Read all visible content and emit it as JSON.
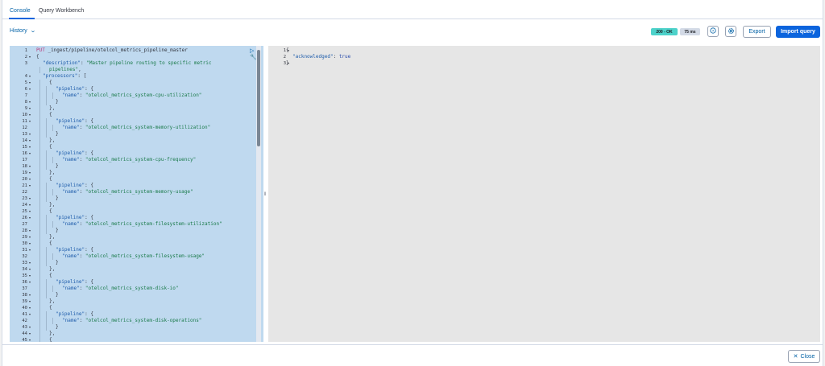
{
  "tabs": [
    {
      "label": "Console",
      "active": true
    },
    {
      "label": "Query Workbench",
      "active": false
    }
  ],
  "history_label": "History",
  "status": {
    "code": "200 - OK",
    "time": "75 ms"
  },
  "toolbar": {
    "export_label": "Export",
    "import_label": "Import query",
    "help_icon": "help-icon",
    "settings_icon": "gear-icon"
  },
  "request": {
    "method": "PUT",
    "url": " _ingest/pipeline/otelcol_metrics_pipeline_master"
  },
  "editor_lines": [
    {
      "n": "1",
      "fold": "",
      "indent": 0,
      "html": "<span class='tok-method'>PUT</span><span class='tok-url'> _ingest/pipeline/otelcol_metrics_pipeline_master</span>"
    },
    {
      "n": "2",
      "fold": "▾",
      "indent": 0,
      "html": "{"
    },
    {
      "n": "3",
      "fold": "",
      "indent": 1,
      "html": "<span class='tok-key'>\"description\"</span>: <span class='tok-str'>\"Master pipeline routing to specific metric</span>"
    },
    {
      "n": "",
      "fold": "",
      "indent": 2,
      "html": "<span class='tok-str'>pipelines\"</span>,"
    },
    {
      "n": "4",
      "fold": "▾",
      "indent": 1,
      "html": "<span class='tok-key'>\"processors\"</span>: ["
    },
    {
      "n": "5",
      "fold": "▾",
      "indent": 2,
      "html": "{"
    },
    {
      "n": "6",
      "fold": "▾",
      "indent": 3,
      "html": "<span class='tok-key'>\"pipeline\"</span>: {"
    },
    {
      "n": "7",
      "fold": "",
      "indent": 4,
      "html": "<span class='tok-key'>\"name\"</span>: <span class='tok-str'>\"otelcol_metrics_system-cpu-utilization\"</span>"
    },
    {
      "n": "8",
      "fold": "▾",
      "indent": 3,
      "html": "}"
    },
    {
      "n": "9",
      "fold": "▾",
      "indent": 2,
      "html": "},"
    },
    {
      "n": "10",
      "fold": "▾",
      "indent": 2,
      "html": "{"
    },
    {
      "n": "11",
      "fold": "▾",
      "indent": 3,
      "html": "<span class='tok-key'>\"pipeline\"</span>: {"
    },
    {
      "n": "12",
      "fold": "",
      "indent": 4,
      "html": "<span class='tok-key'>\"name\"</span>: <span class='tok-str'>\"otelcol_metrics_system-memory-utilization\"</span>"
    },
    {
      "n": "13",
      "fold": "▾",
      "indent": 3,
      "html": "}"
    },
    {
      "n": "14",
      "fold": "▾",
      "indent": 2,
      "html": "},"
    },
    {
      "n": "15",
      "fold": "▾",
      "indent": 2,
      "html": "{"
    },
    {
      "n": "16",
      "fold": "▾",
      "indent": 3,
      "html": "<span class='tok-key'>\"pipeline\"</span>: {"
    },
    {
      "n": "17",
      "fold": "",
      "indent": 4,
      "html": "<span class='tok-key'>\"name\"</span>: <span class='tok-str'>\"otelcol_metrics_system-cpu-frequency\"</span>"
    },
    {
      "n": "18",
      "fold": "▾",
      "indent": 3,
      "html": "}"
    },
    {
      "n": "19",
      "fold": "▾",
      "indent": 2,
      "html": "},"
    },
    {
      "n": "20",
      "fold": "▾",
      "indent": 2,
      "html": "{"
    },
    {
      "n": "21",
      "fold": "▾",
      "indent": 3,
      "html": "<span class='tok-key'>\"pipeline\"</span>: {"
    },
    {
      "n": "22",
      "fold": "",
      "indent": 4,
      "html": "<span class='tok-key'>\"name\"</span>: <span class='tok-str'>\"otelcol_metrics_system-memory-usage\"</span>"
    },
    {
      "n": "23",
      "fold": "▾",
      "indent": 3,
      "html": "}"
    },
    {
      "n": "24",
      "fold": "▾",
      "indent": 2,
      "html": "},"
    },
    {
      "n": "25",
      "fold": "▾",
      "indent": 2,
      "html": "{"
    },
    {
      "n": "26",
      "fold": "▾",
      "indent": 3,
      "html": "<span class='tok-key'>\"pipeline\"</span>: {"
    },
    {
      "n": "27",
      "fold": "",
      "indent": 4,
      "html": "<span class='tok-key'>\"name\"</span>: <span class='tok-str'>\"otelcol_metrics_system-filesystem-utilization\"</span>"
    },
    {
      "n": "28",
      "fold": "▾",
      "indent": 3,
      "html": "}"
    },
    {
      "n": "29",
      "fold": "▾",
      "indent": 2,
      "html": "},"
    },
    {
      "n": "30",
      "fold": "▾",
      "indent": 2,
      "html": "{"
    },
    {
      "n": "31",
      "fold": "▾",
      "indent": 3,
      "html": "<span class='tok-key'>\"pipeline\"</span>: {"
    },
    {
      "n": "32",
      "fold": "",
      "indent": 4,
      "html": "<span class='tok-key'>\"name\"</span>: <span class='tok-str'>\"otelcol_metrics_system-filesystem-usage\"</span>"
    },
    {
      "n": "33",
      "fold": "▾",
      "indent": 3,
      "html": "}"
    },
    {
      "n": "34",
      "fold": "▾",
      "indent": 2,
      "html": "},"
    },
    {
      "n": "35",
      "fold": "▾",
      "indent": 2,
      "html": "{"
    },
    {
      "n": "36",
      "fold": "▾",
      "indent": 3,
      "html": "<span class='tok-key'>\"pipeline\"</span>: {"
    },
    {
      "n": "37",
      "fold": "",
      "indent": 4,
      "html": "<span class='tok-key'>\"name\"</span>: <span class='tok-str'>\"otelcol_metrics_system-disk-io\"</span>"
    },
    {
      "n": "38",
      "fold": "▾",
      "indent": 3,
      "html": "}"
    },
    {
      "n": "39",
      "fold": "▾",
      "indent": 2,
      "html": "},"
    },
    {
      "n": "40",
      "fold": "▾",
      "indent": 2,
      "html": "{"
    },
    {
      "n": "41",
      "fold": "▾",
      "indent": 3,
      "html": "<span class='tok-key'>\"pipeline\"</span>: {"
    },
    {
      "n": "42",
      "fold": "",
      "indent": 4,
      "html": "<span class='tok-key'>\"name\"</span>: <span class='tok-str'>\"otelcol_metrics_system-disk-operations\"</span>"
    },
    {
      "n": "43",
      "fold": "▾",
      "indent": 3,
      "html": "}"
    },
    {
      "n": "44",
      "fold": "▾",
      "indent": 2,
      "html": "},"
    },
    {
      "n": "45",
      "fold": "▾",
      "indent": 2,
      "html": "{"
    }
  ],
  "output_lines": [
    {
      "n": "1",
      "fold": "▾",
      "indent": 0,
      "html": "{"
    },
    {
      "n": "2",
      "fold": "",
      "indent": 1,
      "html": "<span class='tok-key'>\"acknowledged\"</span>: <span class='tok-bool'>true</span>"
    },
    {
      "n": "3",
      "fold": "▾",
      "indent": 0,
      "html": "}"
    }
  ],
  "footer": {
    "close_label": "Close"
  }
}
